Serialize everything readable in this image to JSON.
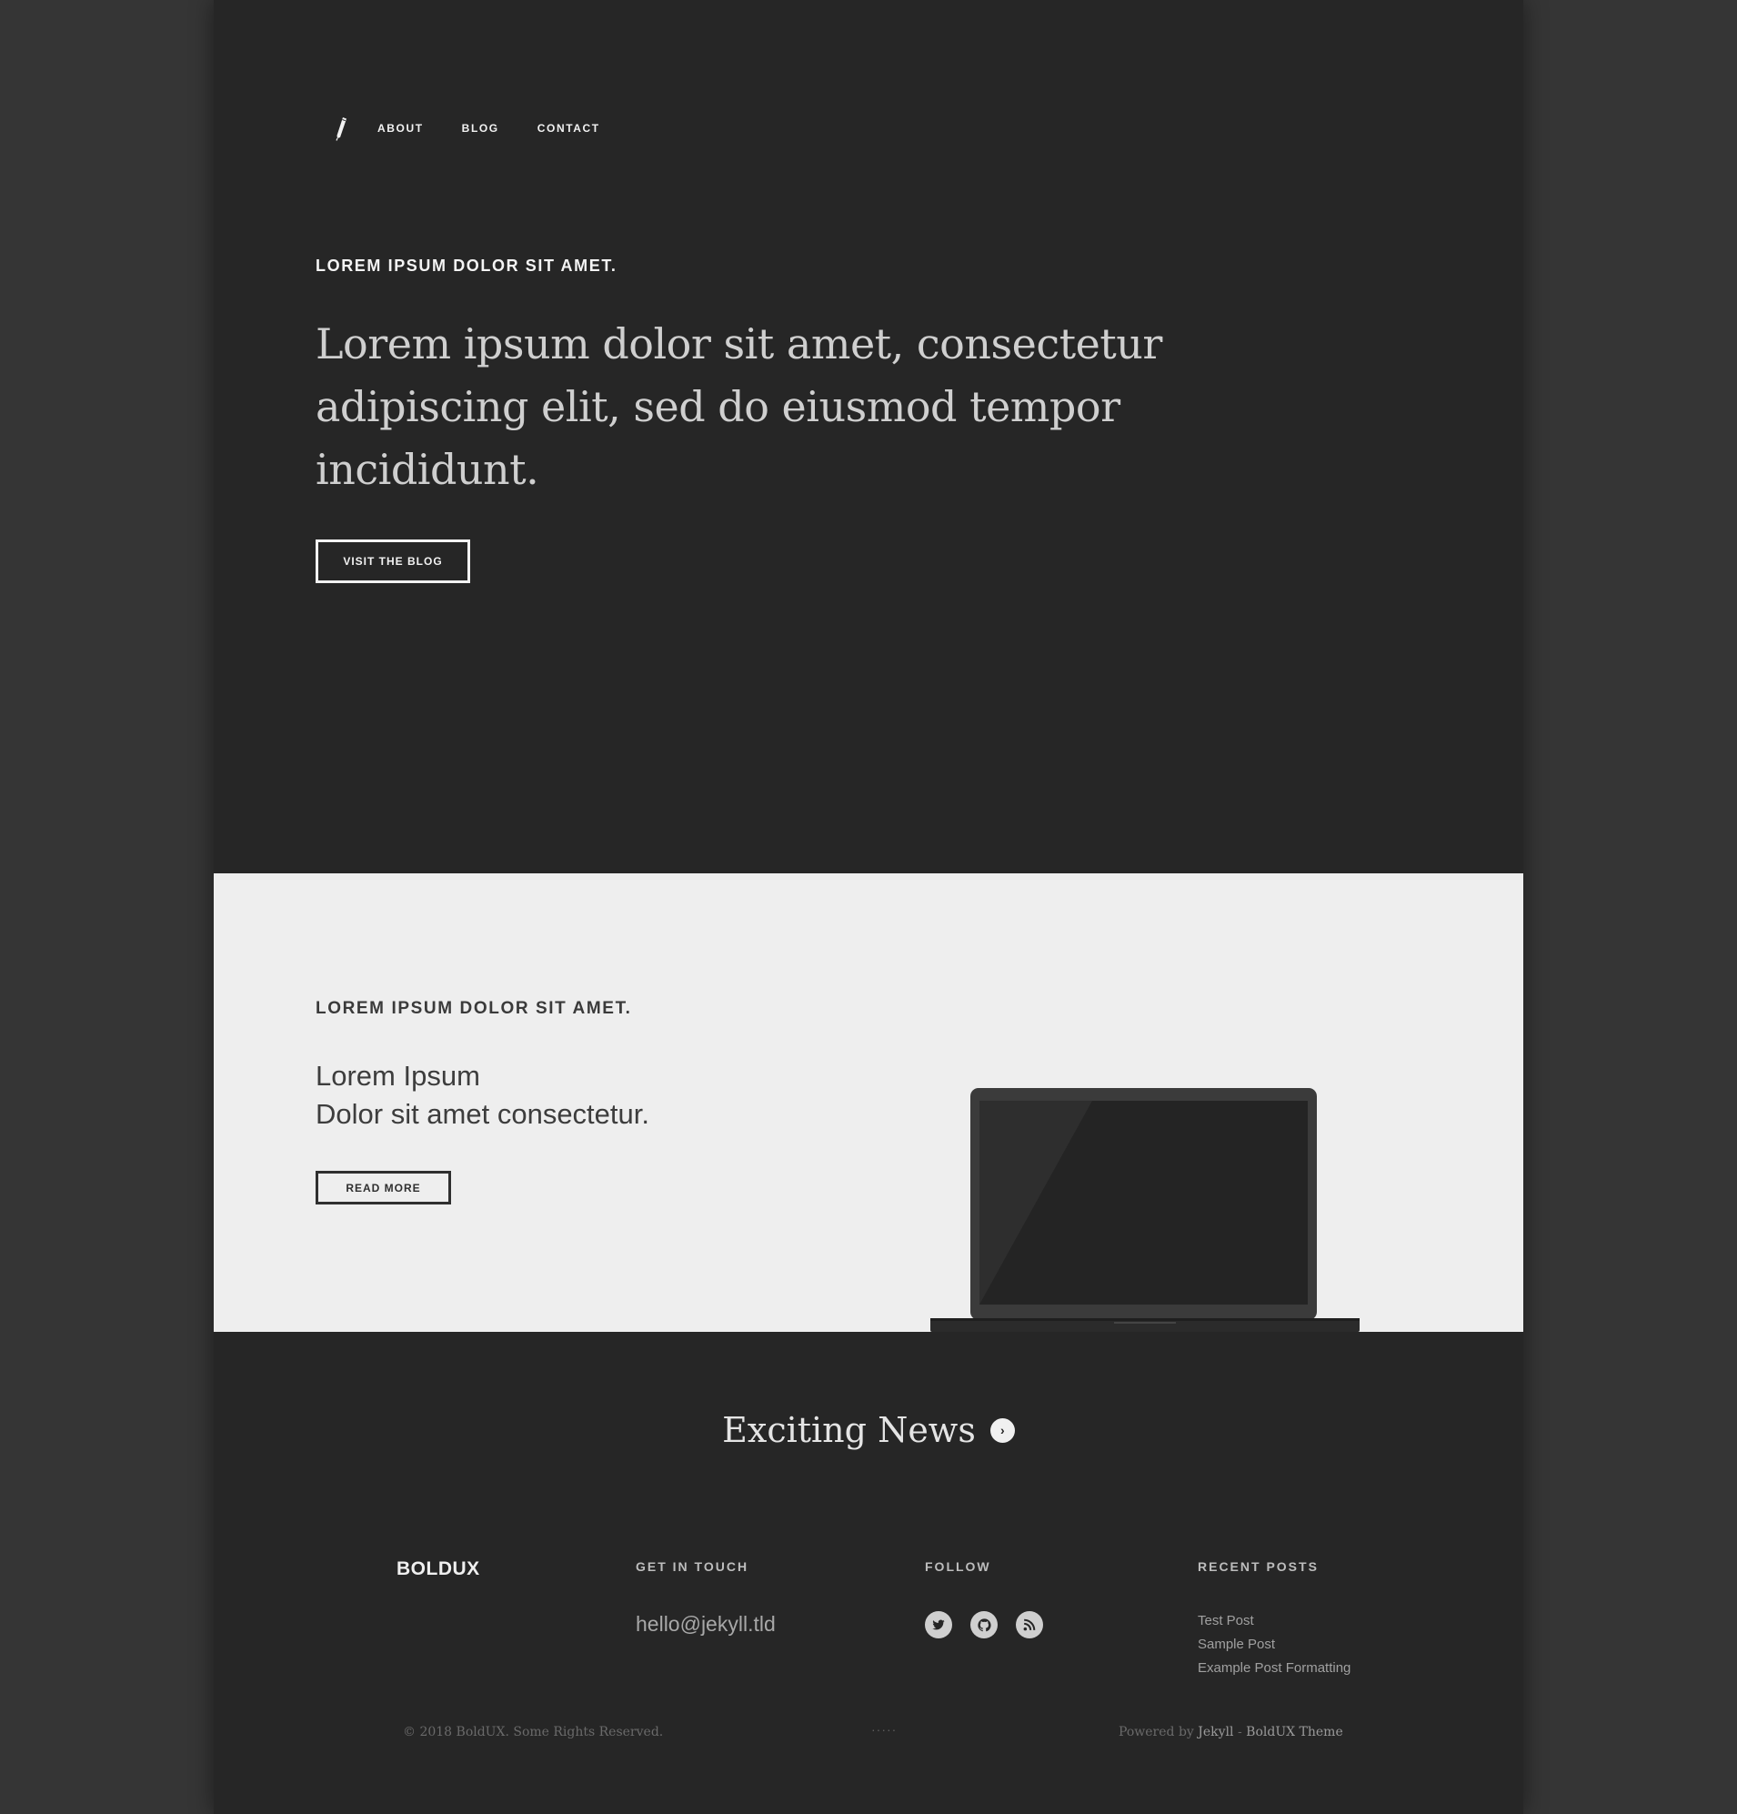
{
  "nav": {
    "logo_icon": "pen-icon",
    "items": [
      {
        "label": "ABOUT"
      },
      {
        "label": "BLOG"
      },
      {
        "label": "CONTACT"
      }
    ]
  },
  "hero": {
    "kicker": "LOREM IPSUM DOLOR SIT AMET.",
    "title": "Lorem ipsum dolor sit amet, consectetur adipiscing elit, sed do eiusmod tempor incididunt.",
    "button_label": "VISIT THE BLOG"
  },
  "feature": {
    "kicker": "LOREM IPSUM DOLOR SIT AMET.",
    "line1": "Lorem Ipsum",
    "line2": "Dolor sit amet consectetur.",
    "button_label": "READ MORE",
    "image_icon": "laptop-icon"
  },
  "news": {
    "title": "Exciting News",
    "arrow_icon": "chevron-right-icon",
    "arrow_glyph": "›"
  },
  "footer": {
    "brand": "BOLDUX",
    "contact_heading": "GET IN TOUCH",
    "email": "hello@jekyll.tld",
    "follow_heading": "FOLLOW",
    "social_icons": [
      "twitter-icon",
      "github-icon",
      "rss-icon"
    ],
    "recent_heading": "RECENT POSTS",
    "recent_posts": [
      "Test Post",
      "Sample Post",
      "Example Post Formatting"
    ],
    "copyright": "© 2018  BoldUX. Some Rights Reserved.",
    "dots": "·····",
    "powered_prefix": "Powered by",
    "powered_link1": "Jekyll",
    "powered_sep": "-",
    "powered_link2": "BoldUX Theme"
  },
  "colors": {
    "page_background": "#262626",
    "outer_background": "#353535",
    "feature_background": "#eeeeee"
  }
}
